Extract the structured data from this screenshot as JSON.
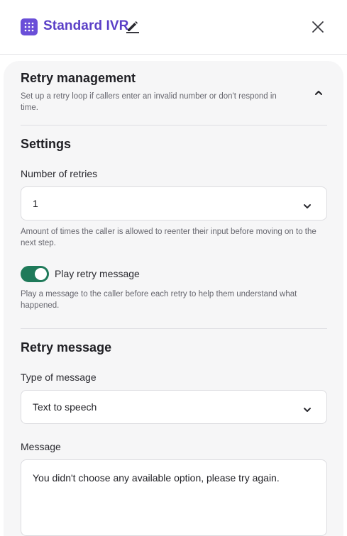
{
  "header": {
    "title": "Standard IVR",
    "app_icon": "keypad-icon",
    "edit_icon": "pencil-icon",
    "close_icon": "close-icon",
    "accent_color": "#5a3fc7"
  },
  "retry_management": {
    "title": "Retry management",
    "description": "Set up a retry loop if callers enter an invalid number or don't respond in time.",
    "collapse_icon": "chevron-up-icon"
  },
  "settings": {
    "title": "Settings",
    "retries_label": "Number of retries",
    "retries_value": "1",
    "retries_help": "Amount of times the caller is allowed to reenter their input before moving on to the next step.",
    "play_retry_label": "Play retry message",
    "play_retry_on": true,
    "play_retry_help": "Play a message to the caller before each retry to help them understand what happened.",
    "toggle_color": "#1f7a5a"
  },
  "retry_message": {
    "title": "Retry message",
    "type_label": "Type of message",
    "type_value": "Text to speech",
    "message_label": "Message",
    "message_value": "You didn't choose any available option, please try again."
  }
}
